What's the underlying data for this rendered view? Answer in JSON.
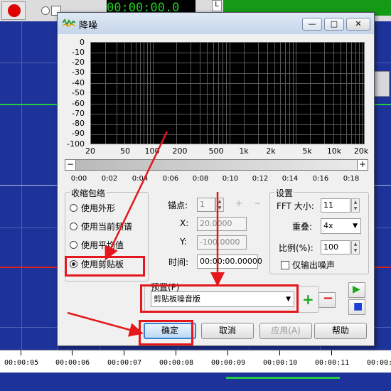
{
  "background": {
    "timecode": "00:00:00.0",
    "small_label": "L",
    "ruler_labels": [
      "00:00:05",
      "00:00:06",
      "00:00:07",
      "00:00:08",
      "00:00:09",
      "00:00:10",
      "00:00:11",
      "00:00:1"
    ]
  },
  "dialog": {
    "title": "降噪",
    "window_controls": {
      "minimize": "—",
      "maximize": "□",
      "close": "✕"
    },
    "plot": {
      "y_ticks": [
        "0",
        "-10",
        "-20",
        "-30",
        "-40",
        "-50",
        "-60",
        "-70",
        "-80",
        "-90",
        "-100"
      ],
      "x_ticks": [
        "20",
        "50",
        "100",
        "200",
        "500",
        "1k",
        "2k",
        "5k",
        "10k",
        "20k"
      ]
    },
    "slider": {
      "minus": "−",
      "plus": "+",
      "ticks": [
        "0:00",
        "0:02",
        "0:04",
        "0:06",
        "0:08",
        "0:10",
        "0:12",
        "0:14",
        "0:16",
        "0:18"
      ]
    },
    "envelope": {
      "title": "收缩包络",
      "options": [
        "使用外形",
        "使用当前频谱",
        "使用平均值",
        "使用剪贴板"
      ],
      "selected_index": 3
    },
    "anchor": {
      "anchor_label": "锚点:",
      "anchor_value": "1",
      "x_label": "X:",
      "x_value": "20.0000",
      "y_label": "Y:",
      "y_value": "-100.0000",
      "time_label": "时间:",
      "time_value": "00:00:00.00000",
      "add_icon": "+",
      "remove_icon": "−"
    },
    "settings": {
      "title": "设置",
      "fft_label": "FFT 大小:",
      "fft_value": "11",
      "overlap_label": "重叠:",
      "overlap_value": "4x",
      "ratio_label": "比例(%):",
      "ratio_value": "100",
      "output_noise_label": "仅输出噪声"
    },
    "preset": {
      "label": "预置(P)",
      "value": "剪贴板噪音版",
      "add_icon": "+",
      "remove_icon": "−"
    },
    "play_icon": "▶",
    "stop_icon": "■",
    "buttons": {
      "ok": "确定",
      "cancel": "取消",
      "apply": "应用(A)",
      "help": "帮助"
    }
  },
  "colors": {
    "highlight": "#e3171c",
    "wave_blue": "#1e3399",
    "wave_green": "#22cc44",
    "timecode_green": "#1fd31f",
    "play_green": "#1aa81a",
    "stop_blue": "#1a3fd8"
  }
}
